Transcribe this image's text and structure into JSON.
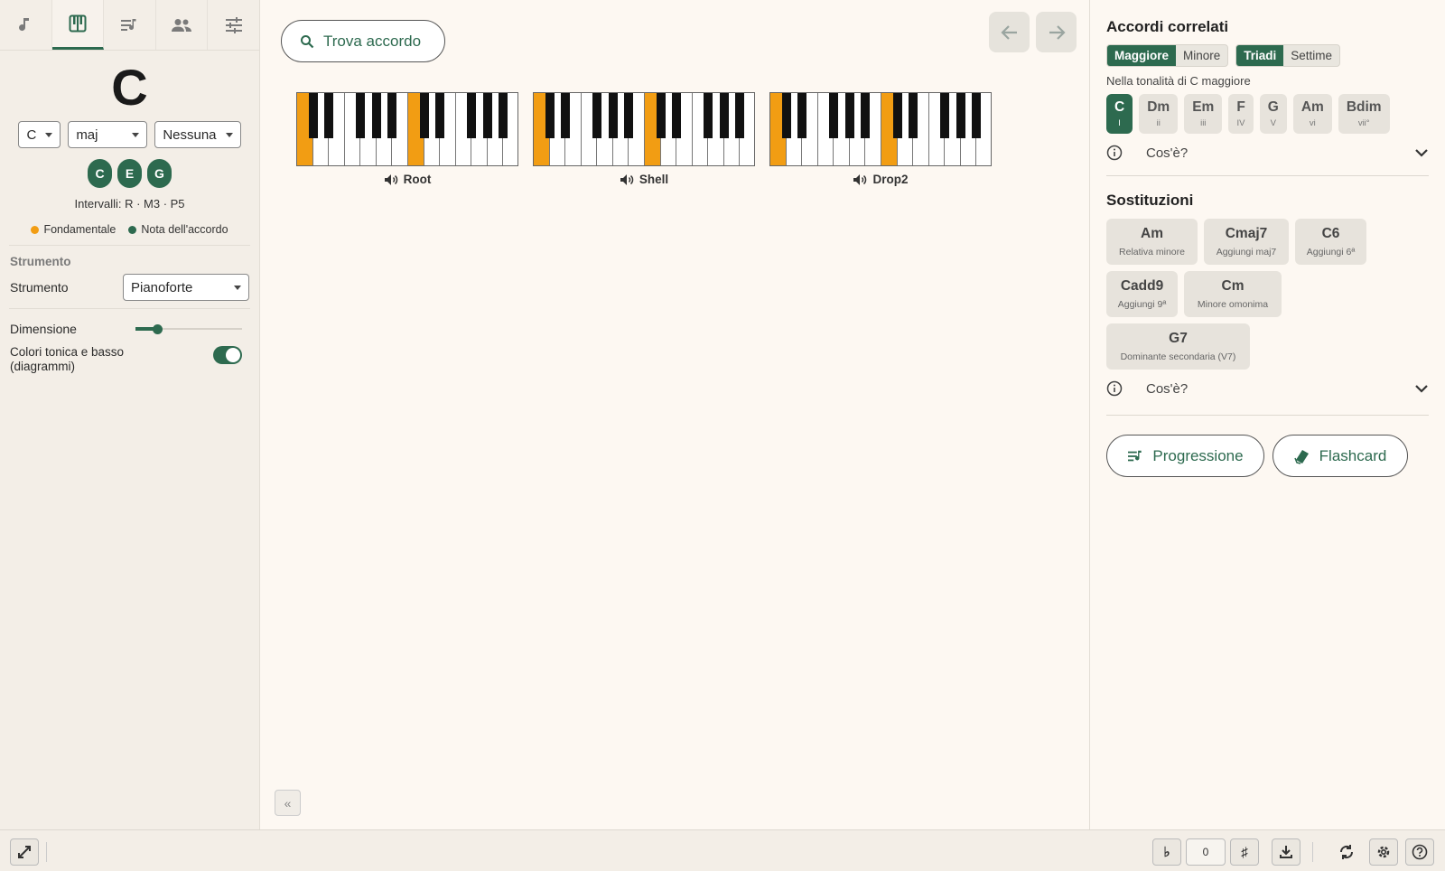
{
  "tabs": [
    {
      "name": "note-icon"
    },
    {
      "name": "piano-icon",
      "active": true
    },
    {
      "name": "playlist-icon"
    },
    {
      "name": "people-icon"
    },
    {
      "name": "sliders-icon"
    }
  ],
  "chord": {
    "name": "C",
    "root": "C",
    "quality": "maj",
    "extension": "Nessuna",
    "notes": [
      "C",
      "E",
      "G"
    ],
    "intervals": "Intervalli: R · M3 · P5"
  },
  "legend": {
    "root": "Fondamentale",
    "chord_note": "Nota dell'accordo",
    "root_color": "#f29d13",
    "note_color": "#2d6a4f"
  },
  "instrument": {
    "section_title": "Strumento",
    "label": "Strumento",
    "value": "Pianoforte"
  },
  "size": {
    "label": "Dimensione",
    "value_fraction": 0.2
  },
  "colors_toggle": {
    "label_line1": "Colori tonica e basso",
    "label_line2": "(diagrammi)",
    "on": true
  },
  "main": {
    "find_label": "Trova accordo",
    "voicings": [
      {
        "label": "Root",
        "highlight_white": [
          0,
          7
        ]
      },
      {
        "label": "Shell",
        "highlight_white": [
          0,
          7
        ]
      },
      {
        "label": "Drop2",
        "highlight_white": [
          0,
          7
        ]
      }
    ],
    "collapse_label": "«"
  },
  "related": {
    "title": "Accordi correlati",
    "mode_options": [
      "Maggiore",
      "Minore"
    ],
    "mode_selected": "Maggiore",
    "type_options": [
      "Triadi",
      "Settime"
    ],
    "type_selected": "Triadi",
    "key_line": "Nella tonalità di C maggiore",
    "chords": [
      {
        "chord": "C",
        "degree": "I",
        "active": true
      },
      {
        "chord": "Dm",
        "degree": "ii"
      },
      {
        "chord": "Em",
        "degree": "iii"
      },
      {
        "chord": "F",
        "degree": "IV"
      },
      {
        "chord": "G",
        "degree": "V"
      },
      {
        "chord": "Am",
        "degree": "vi"
      },
      {
        "chord": "Bdim",
        "degree": "vii°"
      }
    ],
    "cose": "Cos'è?"
  },
  "substitutions": {
    "title": "Sostituzioni",
    "items": [
      {
        "chord": "Am",
        "desc": "Relativa minore"
      },
      {
        "chord": "Cmaj7",
        "desc": "Aggiungi maj7"
      },
      {
        "chord": "C6",
        "desc": "Aggiungi 6ª"
      },
      {
        "chord": "Cadd9",
        "desc": "Aggiungi 9ª"
      },
      {
        "chord": "Cm",
        "desc": "Minore omonima"
      },
      {
        "chord": "G7",
        "desc": "Dominante secondaria (V7)"
      }
    ],
    "cose": "Cos'è?"
  },
  "actions": {
    "progression": "Progressione",
    "flashcard": "Flashcard"
  },
  "bottom": {
    "flat": "♭",
    "transpose": "0",
    "sharp": "♯"
  }
}
